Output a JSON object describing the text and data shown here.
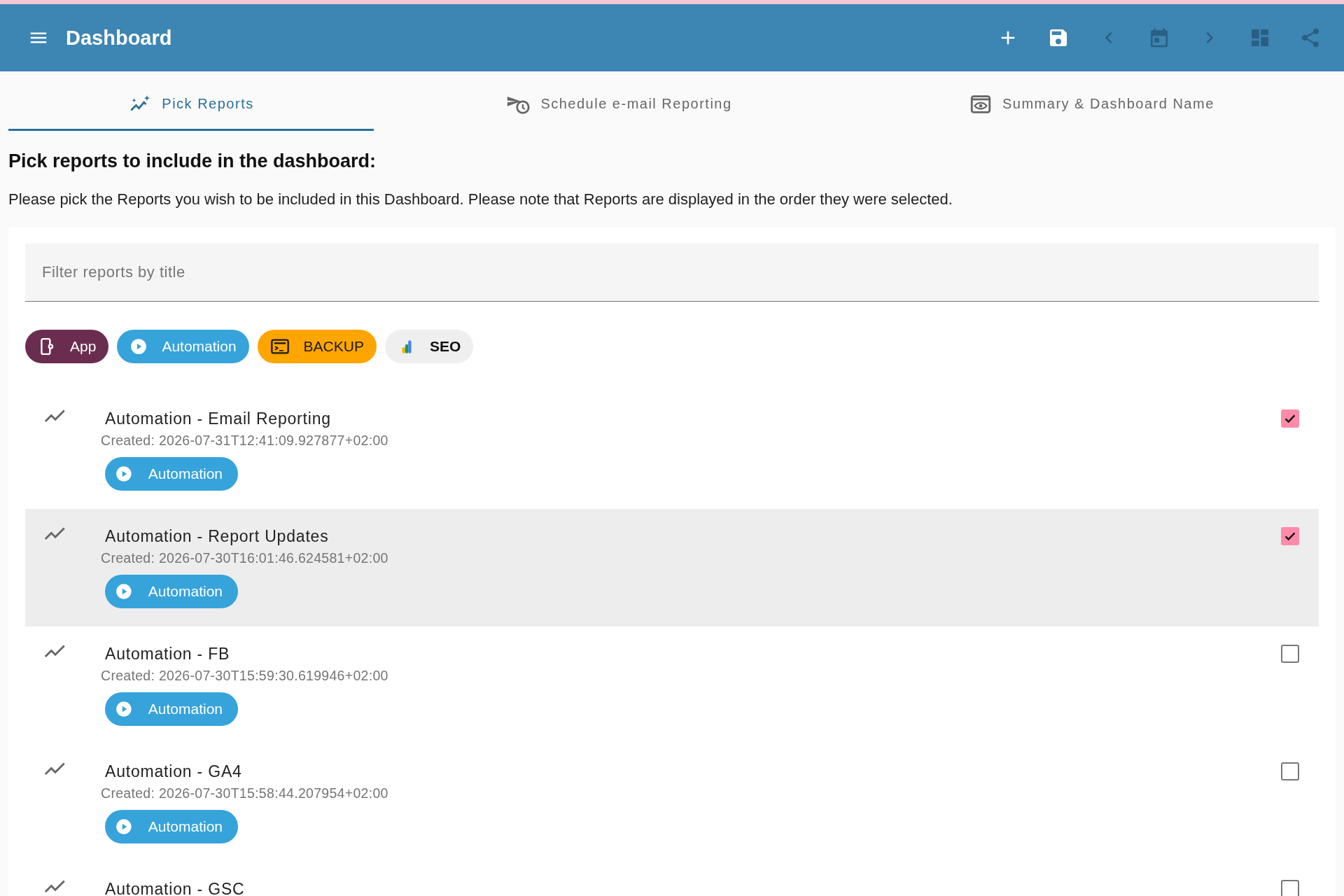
{
  "app_bar": {
    "title": "Dashboard",
    "actions": [
      {
        "kind": "add",
        "disabled": false
      },
      {
        "kind": "save",
        "disabled": false
      },
      {
        "kind": "prev",
        "disabled": true
      },
      {
        "kind": "calendar",
        "disabled": true
      },
      {
        "kind": "next",
        "disabled": true
      },
      {
        "kind": "layout",
        "disabled": true
      },
      {
        "kind": "share",
        "disabled": true
      }
    ]
  },
  "tabs": [
    {
      "label": "Pick Reports",
      "kind": "pick",
      "selected": true
    },
    {
      "label": "Schedule e-mail Reporting",
      "kind": "schedule",
      "selected": false
    },
    {
      "label": "Summary & Dashboard Name",
      "kind": "summary",
      "selected": false
    }
  ],
  "heading": "Pick reports to include in the dashboard:",
  "description": "Please pick the Reports you wish to be included in this Dashboard. Please note that Reports are displayed in the order they were selected.",
  "filter": {
    "placeholder": "Filter reports by title"
  },
  "categories": [
    {
      "label": "App",
      "kind": "app",
      "color": "#6b2d4f"
    },
    {
      "label": "Automation",
      "kind": "automation",
      "color": "#36a3db"
    },
    {
      "label": "BACKUP",
      "kind": "backup",
      "color": "#ffa500"
    },
    {
      "label": "SEO",
      "kind": "seo",
      "color": "#efefef"
    }
  ],
  "reports": [
    {
      "title": "Automation - Email Reporting",
      "created": "Created: 2026-07-31T12:41:09.927877+02:00",
      "checked": true,
      "highlighted": false,
      "tags": [
        {
          "label": "Automation",
          "kind": "automation",
          "color": "#36a3db"
        }
      ]
    },
    {
      "title": "Automation - Report Updates",
      "created": "Created: 2026-07-30T16:01:46.624581+02:00",
      "checked": true,
      "highlighted": true,
      "tags": [
        {
          "label": "Automation",
          "kind": "automation",
          "color": "#36a3db"
        }
      ]
    },
    {
      "title": "Automation - FB",
      "created": "Created: 2026-07-30T15:59:30.619946+02:00",
      "checked": false,
      "highlighted": false,
      "tags": [
        {
          "label": "Automation",
          "kind": "automation",
          "color": "#36a3db"
        }
      ]
    },
    {
      "title": "Automation - GA4",
      "created": "Created: 2026-07-30T15:58:44.207954+02:00",
      "checked": false,
      "highlighted": false,
      "tags": [
        {
          "label": "Automation",
          "kind": "automation",
          "color": "#36a3db"
        }
      ]
    },
    {
      "title": "Automation - GSC",
      "checked": false,
      "highlighted": false
    }
  ]
}
